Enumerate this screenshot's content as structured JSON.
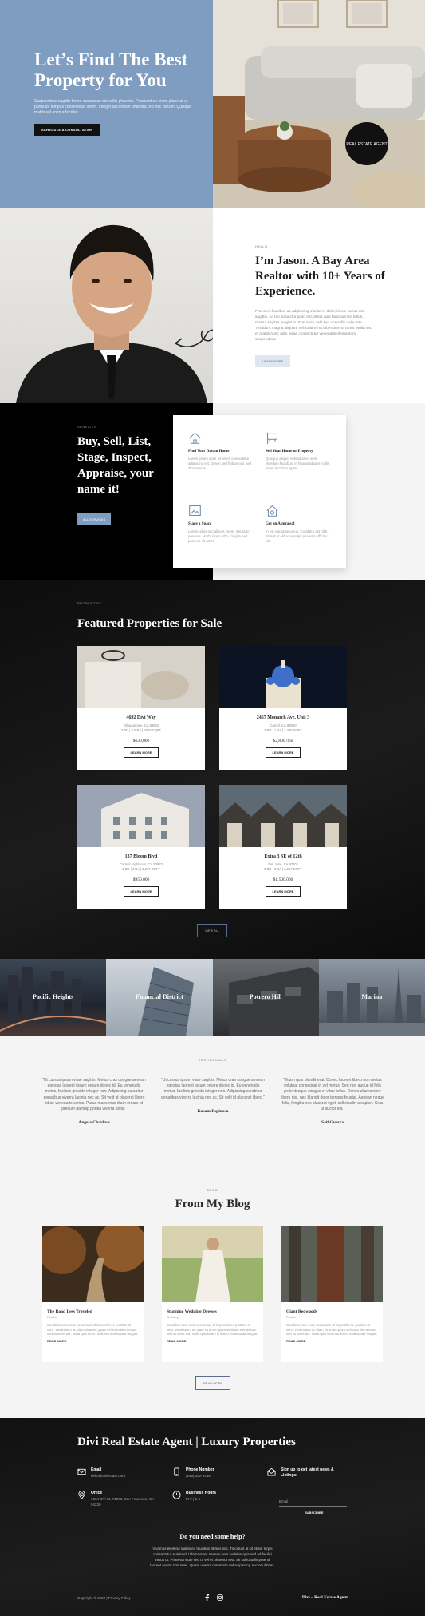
{
  "hero": {
    "title": "Let’s Find The Best Property for You",
    "text": "Suspendisse sagittis lorem accumsan convallis pharetra. Praesent eu enim, placerat ut purus id, tempus consectetur lorem. Integer accumsan pharetra orci nec dictum. Quisque mattis vel enim a facilisis.",
    "button": "SCHEDULE A CONSULTATION",
    "badge": "REAL ESTATE AGENT"
  },
  "about": {
    "eyebrow": "HELLO",
    "title": "I’m Jason. A Bay Area Realtor with 10+ Years of Experience.",
    "text": "Praesent faucibus ac adipiscing massa in dolor, lorem varius nisl sagittis. Ac leo sit auctor justo est, tellus quis faucibus leo tellus, massa sagittis feugiat in. Erat enim velit sed convallis vulputate. Tincidunt magna aliquam vehicula mi et bibendum ut tortor. Nulla sed et mattis nunc odio, vitae consectetur venenatis elementum suspendisse.",
    "button": "LEARN MORE"
  },
  "services": {
    "eyebrow": "SERVICES",
    "title": "Buy, Sell, List, Stage, Inspect, Appraise, your name it!",
    "button": "ALL SERVICES",
    "items": [
      {
        "title": "Find Your Dream Home",
        "text": "Lorem ipsum dolor sit amet, consectetur adipiscing elit. Donec sed finibus nisi, sed dictum eros.",
        "icon": "house-icon"
      },
      {
        "title": "Sell Your Home or Property",
        "text": "Quisque aliquet velit sit amet sem interdum faucibus. In feugiat aliquet mollis etiam tincidunt ligula.",
        "icon": "sign-icon"
      },
      {
        "title": "Stage a Space",
        "text": "Lorem tellus nec aliquet lorem, interdum posuere. Morbi lorem nibh, fringilla sed posuere sit amet.",
        "icon": "frame-icon"
      },
      {
        "title": "Get an Appraisal",
        "text": "In est vulputate purus. Curabitur est nibh, blandit et elit ac suscipit pharetra efficitur elit.",
        "icon": "appraisal-icon"
      }
    ]
  },
  "properties": {
    "eyebrow": "PROPERTIES",
    "title": "Featured Properties for Sale",
    "button": "VIEW ALL",
    "items": [
      {
        "name": "4692 Divi Way",
        "city": "Albuquerque, CA 93652",
        "specs": "3 BD | 2.5 BA | 2015 SQFT",
        "price": "$630,000",
        "button": "LEARN MORE"
      },
      {
        "name": "2467 Monarch Ave. Unit 3",
        "city": "Carnel, CA 93950",
        "specs": "3 BD | 1 BA | 2,385 SQFT",
        "price": "$2,800 /mo",
        "button": "LEARN MORE"
      },
      {
        "name": "137 Bloom Blvd",
        "city": "Carmel Highlands, CA 93923",
        "specs": "3 BD | 4 BA | 3,217 SQFT",
        "price": "$950,000",
        "button": "LEARN MORE"
      },
      {
        "name": "Extra 3 SE of 12th",
        "city": "San Jose, CA 97601",
        "specs": "3 BD | 3 BA | 3,217 SQFT",
        "price": "$1,500,000",
        "button": "LEARN MORE"
      }
    ]
  },
  "neighborhoods": [
    "Pacific Heights",
    "Financial District",
    "Potrero Hill",
    "Marina"
  ],
  "testimonials": {
    "eyebrow": "TESTIMONIALS",
    "items": [
      {
        "quote": "“Ut cursus ipsum vitae sagittis. Metus cras congue aenean egestas laoreet ipsum ornare donec id. Eu venenatis metus, facilisis gravida integer non. Adipiscing curabitur penatibus viverra lacinia nec ac. Sit velit id placerat libero id ac venenatis varius. Purus maecenas diam ornare id pretium damnip porttia viverra dolor.”",
        "name": "Angela Charlton"
      },
      {
        "quote": "“Ut cursus ipsum vitae sagittis. Metus cras congue aenean egestas laoreet ipsum ornare donec id. Eu venenatis metus, facilisis gravida integer non. Adipiscing curabitur penatibus viverra lacinia nec ac. Sit velit id placerat libero.”",
        "name": "Kasam Espinosa"
      },
      {
        "quote": "“Etiam quis blandit erat. Donec laoreet libero non metus volutpat consequat in vel metus. Sed non augue id felis pellentesque congue et vitae tellus. Donec ullamcorper libero nisl, nec blandit dolor tempus feugiat. Aenean neque felis, fringilla nec placerat eget, sollicitudin a sapien. Cras ut auctor elit.”",
        "name": "Saif Guerra"
      }
    ]
  },
  "blog": {
    "eyebrow": "BLOG",
    "title": "From My Blog",
    "button": "READ MORE",
    "items": [
      {
        "title": "The Road Less Traveled",
        "category": "Realtor",
        "text": "Curabitur arcu erat, accumsan id imperdiet et, porttitor at sem. Vestibulum ac diam sit amet quam vehicula elementum sed sit amet dui. Nulla quis lorem ut libero malesuada feugiat.",
        "link": "READ MORE"
      },
      {
        "title": "Stunning Wedding Dresses",
        "category": "Wedding",
        "text": "Curabitur arcu erat, accumsan id imperdiet et, porttitor at sem. Vestibulum ac diam sit amet quam vehicula elementum sed sit amet dui. Nulla quis lorem ut libero malesuada feugiat.",
        "link": "READ MORE"
      },
      {
        "title": "Giant Redwoods",
        "category": "Realtor",
        "text": "Curabitur arcu erat, accumsan id imperdiet et, porttitor at sem. Vestibulum ac diam sit amet quam vehicula elementum sed sit amet dui. Nulla quis lorem ut libero malesuada feugiat.",
        "link": "READ MORE"
      }
    ]
  },
  "footer": {
    "title": "Divi Real Estate Agent | Luxury Properties",
    "email_label": "Email",
    "email_value": "hello@diviestate.com",
    "phone_label": "Phone Number",
    "phone_value": "(255) 352-6258",
    "office_label": "Office",
    "office_value": "1234 Divi St. #1000, San Francisco, CA 94220",
    "hours_label": "Business Hours",
    "hours_value": "M-F | 9-6",
    "news_label": "Sign up to get latest news & Listings:",
    "email_placeholder": "Email",
    "subscribe": "SUBSCRIBE",
    "need_title": "Do you need some help?",
    "need_text": "Vivamus eleifend mattis eu faucibus at felis nec. Tincidunt at sit etiam turpis consectetur euismod. Ullamcorper aenean sem sodales quis sed ad facilisi netus ut. Pharetra vitae sed ut vel et pharetra sed. Sit sollicitudin potenti laoreet auctor non nunc. Quam viverra commodo vel adipiscing auctor ultrices.",
    "copyright": "Copyright © 2022 | Privacy Policy",
    "brand": "Divi – Real Estate Agent"
  }
}
